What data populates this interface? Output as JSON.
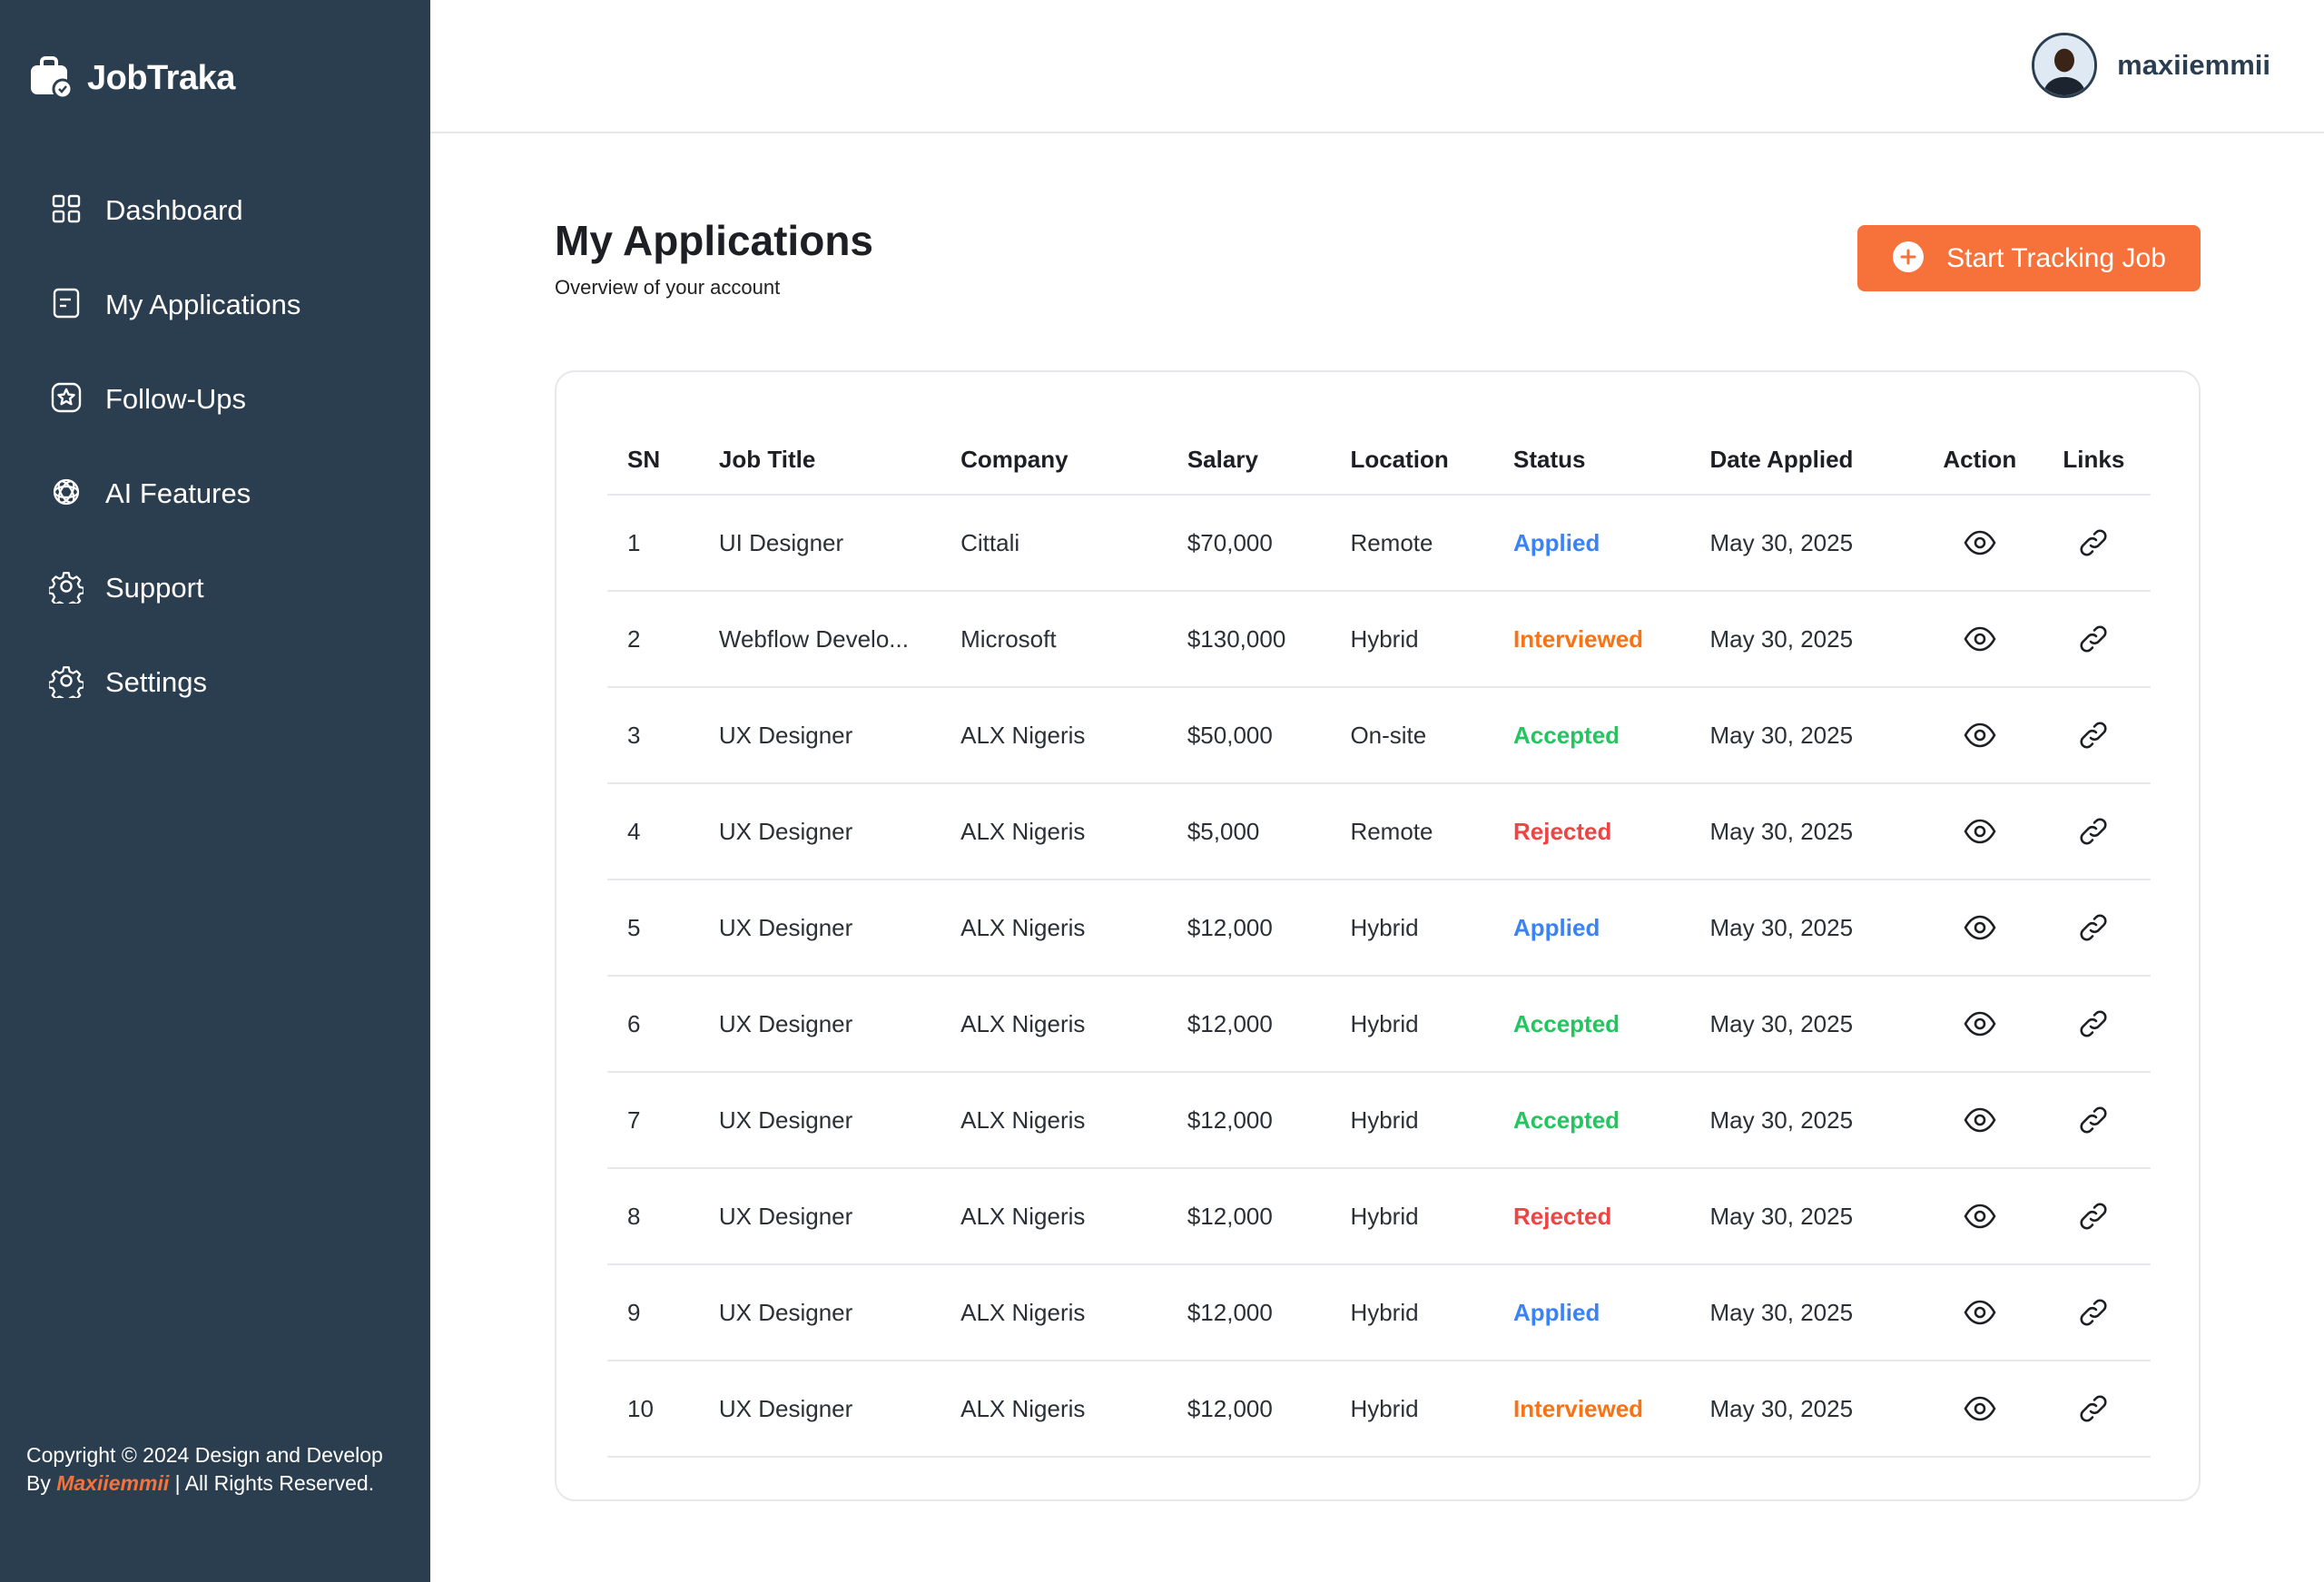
{
  "brand": {
    "name": "JobTraka"
  },
  "sidebar": {
    "items": [
      {
        "label": "Dashboard",
        "icon": "grid-icon"
      },
      {
        "label": "My Applications",
        "icon": "document-icon"
      },
      {
        "label": "Follow-Ups",
        "icon": "star-badge-icon"
      },
      {
        "label": "AI Features",
        "icon": "ai-knot-icon"
      },
      {
        "label": "Support",
        "icon": "gear-icon"
      },
      {
        "label": "Settings",
        "icon": "gear-icon"
      }
    ],
    "copyright_prefix": "Copyright © 2024 Design and Develop By ",
    "copyright_author": "Maxiiemmii",
    "copyright_suffix": " | All Rights Reserved."
  },
  "header": {
    "username": "maxiiemmii"
  },
  "main": {
    "title": "My Applications",
    "subtitle": "Overview of your account",
    "cta_label": "Start Tracking Job"
  },
  "colors": {
    "sidebar_bg": "#2b3e50",
    "accent": "#f7723a",
    "applied": "#3b82f6",
    "interviewed": "#f97316",
    "accepted": "#22c55e",
    "rejected": "#ef4444"
  },
  "table": {
    "headers": [
      "SN",
      "Job Title",
      "Company",
      "Salary",
      "Location",
      "Status",
      "Date Applied",
      "Action",
      "Links"
    ],
    "rows": [
      {
        "sn": "1",
        "title": "UI Designer",
        "company": "Cittali",
        "salary": "$70,000",
        "location": "Remote",
        "status": "Applied",
        "date": "May 30, 2025"
      },
      {
        "sn": "2",
        "title": "Webflow Develo...",
        "company": "Microsoft",
        "salary": "$130,000",
        "location": "Hybrid",
        "status": "Interviewed",
        "date": "May 30, 2025"
      },
      {
        "sn": "3",
        "title": "UX Designer",
        "company": "ALX Nigeris",
        "salary": "$50,000",
        "location": "On-site",
        "status": "Accepted",
        "date": "May 30, 2025"
      },
      {
        "sn": "4",
        "title": "UX Designer",
        "company": "ALX Nigeris",
        "salary": "$5,000",
        "location": "Remote",
        "status": "Rejected",
        "date": "May 30, 2025"
      },
      {
        "sn": "5",
        "title": "UX Designer",
        "company": "ALX Nigeris",
        "salary": "$12,000",
        "location": "Hybrid",
        "status": "Applied",
        "date": "May 30, 2025"
      },
      {
        "sn": "6",
        "title": "UX Designer",
        "company": "ALX Nigeris",
        "salary": "$12,000",
        "location": "Hybrid",
        "status": "Accepted",
        "date": "May 30, 2025"
      },
      {
        "sn": "7",
        "title": "UX Designer",
        "company": "ALX Nigeris",
        "salary": "$12,000",
        "location": "Hybrid",
        "status": "Accepted",
        "date": "May 30, 2025"
      },
      {
        "sn": "8",
        "title": "UX Designer",
        "company": "ALX Nigeris",
        "salary": "$12,000",
        "location": "Hybrid",
        "status": "Rejected",
        "date": "May 30, 2025"
      },
      {
        "sn": "9",
        "title": "UX Designer",
        "company": "ALX Nigeris",
        "salary": "$12,000",
        "location": "Hybrid",
        "status": "Applied",
        "date": "May 30, 2025"
      },
      {
        "sn": "10",
        "title": "UX Designer",
        "company": "ALX Nigeris",
        "salary": "$12,000",
        "location": "Hybrid",
        "status": "Interviewed",
        "date": "May 30, 2025"
      }
    ]
  }
}
